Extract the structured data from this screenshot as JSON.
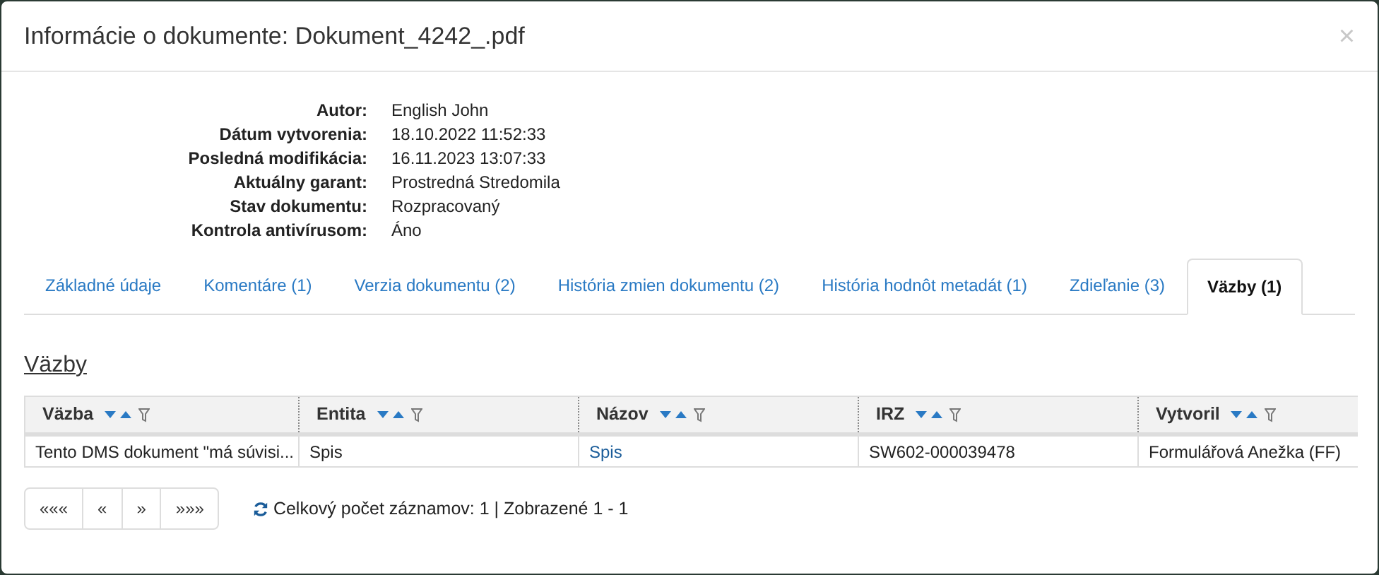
{
  "dialog": {
    "title": "Informácie o dokumente: Dokument_4242_.pdf",
    "close": "×"
  },
  "info": [
    {
      "label": "Autor:",
      "value": "English John"
    },
    {
      "label": "Dátum vytvorenia:",
      "value": "18.10.2022 11:52:33"
    },
    {
      "label": "Posledná modifikácia:",
      "value": "16.11.2023 13:07:33"
    },
    {
      "label": "Aktuálny garant:",
      "value": "Prostredná Stredomila"
    },
    {
      "label": "Stav dokumentu:",
      "value": "Rozpracovaný"
    },
    {
      "label": "Kontrola antivírusom:",
      "value": "Áno"
    }
  ],
  "tabs": [
    {
      "label": "Základné údaje",
      "selected": false
    },
    {
      "label": "Komentáre (1)",
      "selected": false
    },
    {
      "label": "Verzia dokumentu (2)",
      "selected": false
    },
    {
      "label": "História zmien dokumentu (2)",
      "selected": false
    },
    {
      "label": "História hodnôt metadát (1)",
      "selected": false
    },
    {
      "label": "Zdieľanie (3)",
      "selected": false
    },
    {
      "label": "Väzby (1)",
      "selected": true
    }
  ],
  "section_title": "Väzby",
  "table": {
    "columns": [
      "Väzba",
      "Entita",
      "Názov",
      "IRZ",
      "Vytvoril"
    ],
    "rows": [
      [
        {
          "text": "Tento DMS dokument \"má súvisi...",
          "kind": "text"
        },
        {
          "text": "Spis",
          "kind": "text"
        },
        {
          "text": "Spis",
          "kind": "link"
        },
        {
          "text": "SW602-000039478",
          "kind": "text"
        },
        {
          "text": "Formulářová Anežka (FF)",
          "kind": "text"
        }
      ]
    ]
  },
  "pagination": {
    "buttons": [
      "«««",
      "«",
      "»",
      "»»»"
    ],
    "summary": "Celkový počet záznamov: 1 | Zobrazené 1 - 1"
  }
}
